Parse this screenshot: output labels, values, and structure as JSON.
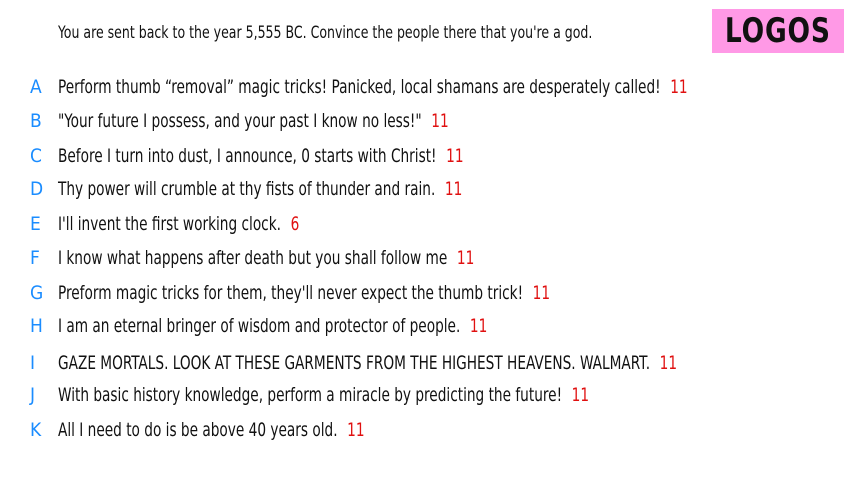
{
  "prompt": "You are sent back to the year 5,555 BC. Convince the people there that you're a god.",
  "logo": "LOGOS",
  "colors": {
    "letter": "#1a8cff",
    "score": "#e01010",
    "logo_background": "#ff99e6"
  },
  "answers": [
    {
      "letter": "A",
      "text": "Perform thumb “removal” magic tricks! Panicked, local shamans are desperately called!",
      "score": "11"
    },
    {
      "letter": "B",
      "text": "\"Your future I possess, and your past I know no less!\"",
      "score": "11"
    },
    {
      "letter": "C",
      "text": "Before I turn into dust, I announce, 0 starts with Christ!",
      "score": "11"
    },
    {
      "letter": "D",
      "text": "Thy power will crumble at thy fists of thunder and rain.",
      "score": "11"
    },
    {
      "letter": "E",
      "text": "I'll invent the first working clock.",
      "score": "6"
    },
    {
      "letter": "F",
      "text": "I know what happens after death but you shall follow me",
      "score": "11"
    },
    {
      "letter": "G",
      "text": "Preform magic tricks for them, they'll never expect the thumb trick!",
      "score": "11"
    },
    {
      "letter": "H",
      "text": "I am an eternal bringer of wisdom and protector of people.",
      "score": "11"
    },
    {
      "letter": "I",
      "text": "GAZE MORTALS. LOOK AT THESE GARMENTS FROM THE HIGHEST HEAVENS. WALMART.",
      "score": "11"
    },
    {
      "letter": "J",
      "text": "With basic history knowledge, perform a miracle by predicting the future!",
      "score": "11"
    },
    {
      "letter": "K",
      "text": "All I need to do is be above 40 years old.",
      "score": "11"
    }
  ]
}
